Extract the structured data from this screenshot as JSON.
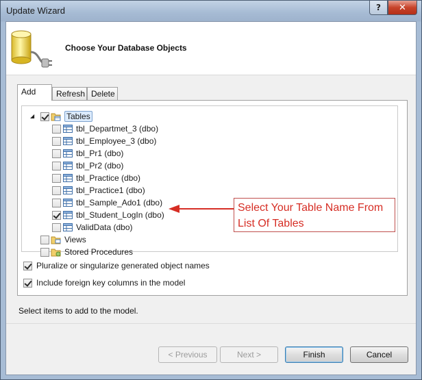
{
  "window": {
    "title": "Update Wizard",
    "help_glyph": "?",
    "close_glyph": "✕"
  },
  "header": {
    "title": "Choose Your Database Objects",
    "icon": "database-plug-icon"
  },
  "tabs": [
    {
      "label": "Add",
      "active": true
    },
    {
      "label": "Refresh",
      "active": false
    },
    {
      "label": "Delete",
      "active": false
    }
  ],
  "tree": {
    "tables": {
      "label": "Tables",
      "state": "checked",
      "expanded": true
    },
    "table_items": [
      {
        "label": "tbl_Departmet_3 (dbo)",
        "checked": false
      },
      {
        "label": "tbl_Employee_3 (dbo)",
        "checked": false
      },
      {
        "label": "tbl_Pr1 (dbo)",
        "checked": false
      },
      {
        "label": "tbl_Pr2 (dbo)",
        "checked": false
      },
      {
        "label": "tbl_Practice (dbo)",
        "checked": false
      },
      {
        "label": "tbl_Practice1 (dbo)",
        "checked": false
      },
      {
        "label": "tbl_Sample_Ado1 (dbo)",
        "checked": false
      },
      {
        "label": "tbl_Student_LogIn (dbo)",
        "checked": true
      },
      {
        "label": "ValidData (dbo)",
        "checked": false
      }
    ],
    "views": {
      "label": "Views",
      "checked": false
    },
    "procedures": {
      "label": "Stored Procedures",
      "checked": false
    }
  },
  "options": {
    "pluralize": {
      "label": "Pluralize or singularize generated object names",
      "checked": true
    },
    "foreign_keys": {
      "label": "Include foreign key columns in the model",
      "checked": true
    }
  },
  "status": "Select items to add to the model.",
  "buttons": {
    "previous": "< Previous",
    "next": "Next >",
    "finish": "Finish",
    "cancel": "Cancel"
  },
  "annotation": {
    "text_line1": "Select Your Table Name From",
    "text_line2": "List Of Tables",
    "color": "#d62d24"
  }
}
